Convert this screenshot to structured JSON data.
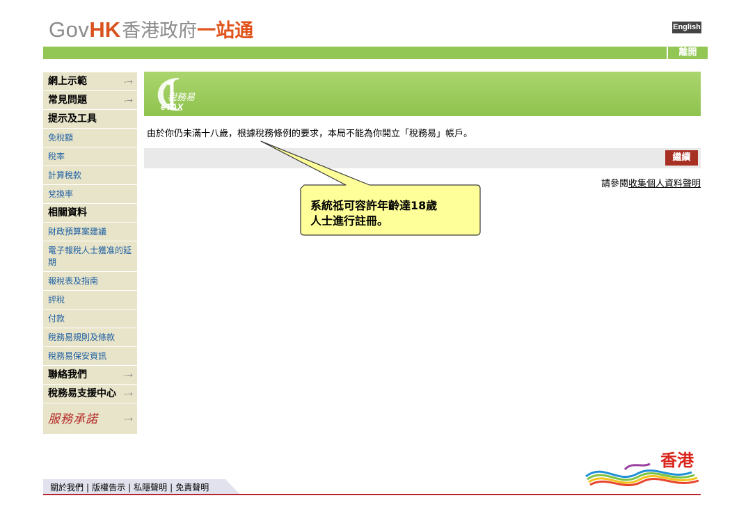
{
  "header": {
    "logo_gov": "Gov",
    "logo_hk": "HK",
    "logo_cn_gray": "香港政府",
    "logo_cn_orange": "一站通",
    "language_button": "English",
    "exit_button": "離開"
  },
  "sidebar": {
    "items": [
      {
        "label": "網上示範",
        "type": "main",
        "arrow": "-→"
      },
      {
        "label": "常見問題",
        "type": "main",
        "arrow": "-→"
      },
      {
        "label": "提示及工具",
        "type": "head"
      },
      {
        "label": "免稅額",
        "type": "sub"
      },
      {
        "label": "稅率",
        "type": "sub"
      },
      {
        "label": "計算稅款",
        "type": "sub"
      },
      {
        "label": "兌換率",
        "type": "sub"
      },
      {
        "label": "相關資料",
        "type": "head"
      },
      {
        "label": "財政預算案建議",
        "type": "sub"
      },
      {
        "label": "電子報稅人士獲准的延期",
        "type": "tall"
      },
      {
        "label": "報稅表及指南",
        "type": "sub"
      },
      {
        "label": "評稅",
        "type": "sub"
      },
      {
        "label": "付款",
        "type": "sub"
      },
      {
        "label": "稅務易規則及條款",
        "type": "sub"
      },
      {
        "label": "稅務易保安資訊",
        "type": "sub"
      },
      {
        "label": "聯絡我們",
        "type": "main",
        "arrow": "-→"
      },
      {
        "label": "稅務易支援中心",
        "type": "main",
        "arrow": "-→"
      },
      {
        "label": "服務承諾",
        "type": "brand",
        "arrow": "-→"
      }
    ]
  },
  "banner": {
    "logo_cn": "稅務易",
    "logo_en": "eTAX"
  },
  "main": {
    "message": "由於你仍未滿十八歲，根據稅務條例的要求，本局不能為你開立「稅務易」帳戶。",
    "continue_button": "繼續",
    "pics_prefix": "請參閱",
    "pics_link": "收集個人資料聲明"
  },
  "callout": {
    "line1": "系統祗可容許年齡達18歲",
    "line2": "人士進行註冊。"
  },
  "footer": {
    "links": [
      "關於我們",
      "版權告示",
      "私隱聲明",
      "免責聲明"
    ],
    "separator": "|",
    "brand_text": "香港"
  },
  "colors": {
    "accent_green": "#92c755",
    "continue_red": "#a83023",
    "logo_orange": "#d9531e",
    "sidebar_bg": "#e8e4c9",
    "link_blue": "#1c5fa3",
    "callout_fill": "#ffff99"
  }
}
